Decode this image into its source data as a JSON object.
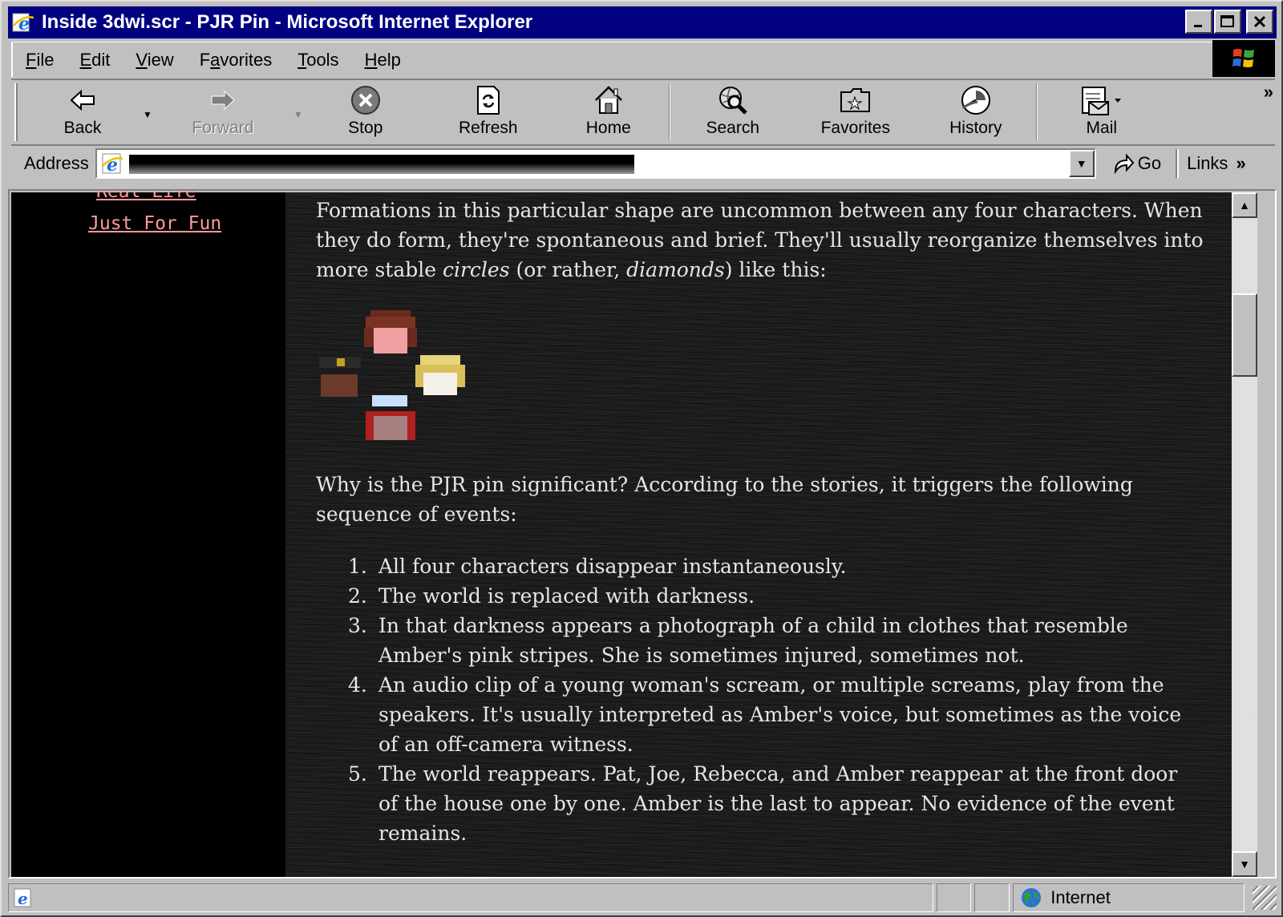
{
  "window": {
    "title": "Inside 3dwi.scr - PJR Pin - Microsoft Internet Explorer",
    "controls": {
      "minimize": "_",
      "maximize": "□",
      "close": "✕"
    }
  },
  "menu": [
    {
      "pre": "",
      "ul": "F",
      "post": "ile"
    },
    {
      "pre": "",
      "ul": "E",
      "post": "dit"
    },
    {
      "pre": "",
      "ul": "V",
      "post": "iew"
    },
    {
      "pre": "F",
      "ul": "a",
      "post": "vorites"
    },
    {
      "pre": "",
      "ul": "T",
      "post": "ools"
    },
    {
      "pre": "",
      "ul": "H",
      "post": "elp"
    }
  ],
  "toolbar": {
    "back": "Back",
    "forward": "Forward",
    "stop": "Stop",
    "refresh": "Refresh",
    "home": "Home",
    "search": "Search",
    "favorites": "Favorites",
    "history": "History",
    "mail": "Mail",
    "more": "»"
  },
  "address": {
    "label": "Address",
    "go": "Go",
    "links": "Links",
    "links_more": "»"
  },
  "sidebar": {
    "links": [
      "Real Life",
      "Just For Fun"
    ]
  },
  "article": {
    "p1_a": "Formations in this particular shape are uncommon between any four characters. When they do form, they're spontaneous and brief. They'll usually reorganize themselves into more stable ",
    "p1_em1": "circles",
    "p1_b": " (or rather, ",
    "p1_em2": "diamonds",
    "p1_c": ") like this:",
    "p2": "Why is the PJR pin significant? According to the stories, it triggers the following sequence of events:",
    "list": [
      {
        "n": "1.",
        "text": "All four characters disappear instantaneously."
      },
      {
        "n": "2.",
        "text": "The world is replaced with darkness."
      },
      {
        "n": "3.",
        "text": "In that darkness appears a photograph of a child in clothes that resemble Amber's pink stripes. She is sometimes injured, sometimes not."
      },
      {
        "n": "4.",
        "text": "An audio clip of a young woman's scream, or multiple screams, play from the speakers. It's usually interpreted as Amber's voice, but sometimes as the voice of an off-camera witness."
      },
      {
        "n": "5.",
        "text": "The world reappears. Pat, Joe, Rebecca, and Amber reappear at the front door of the house one by one. Amber is the last to appear. No evidence of the event remains."
      }
    ]
  },
  "status": {
    "zone": "Internet"
  },
  "colors": {
    "titlebar": "#000080",
    "chrome": "#c0c0c0",
    "sidebar_link": "#ff9a9a",
    "article_text": "#e6e6e6"
  }
}
